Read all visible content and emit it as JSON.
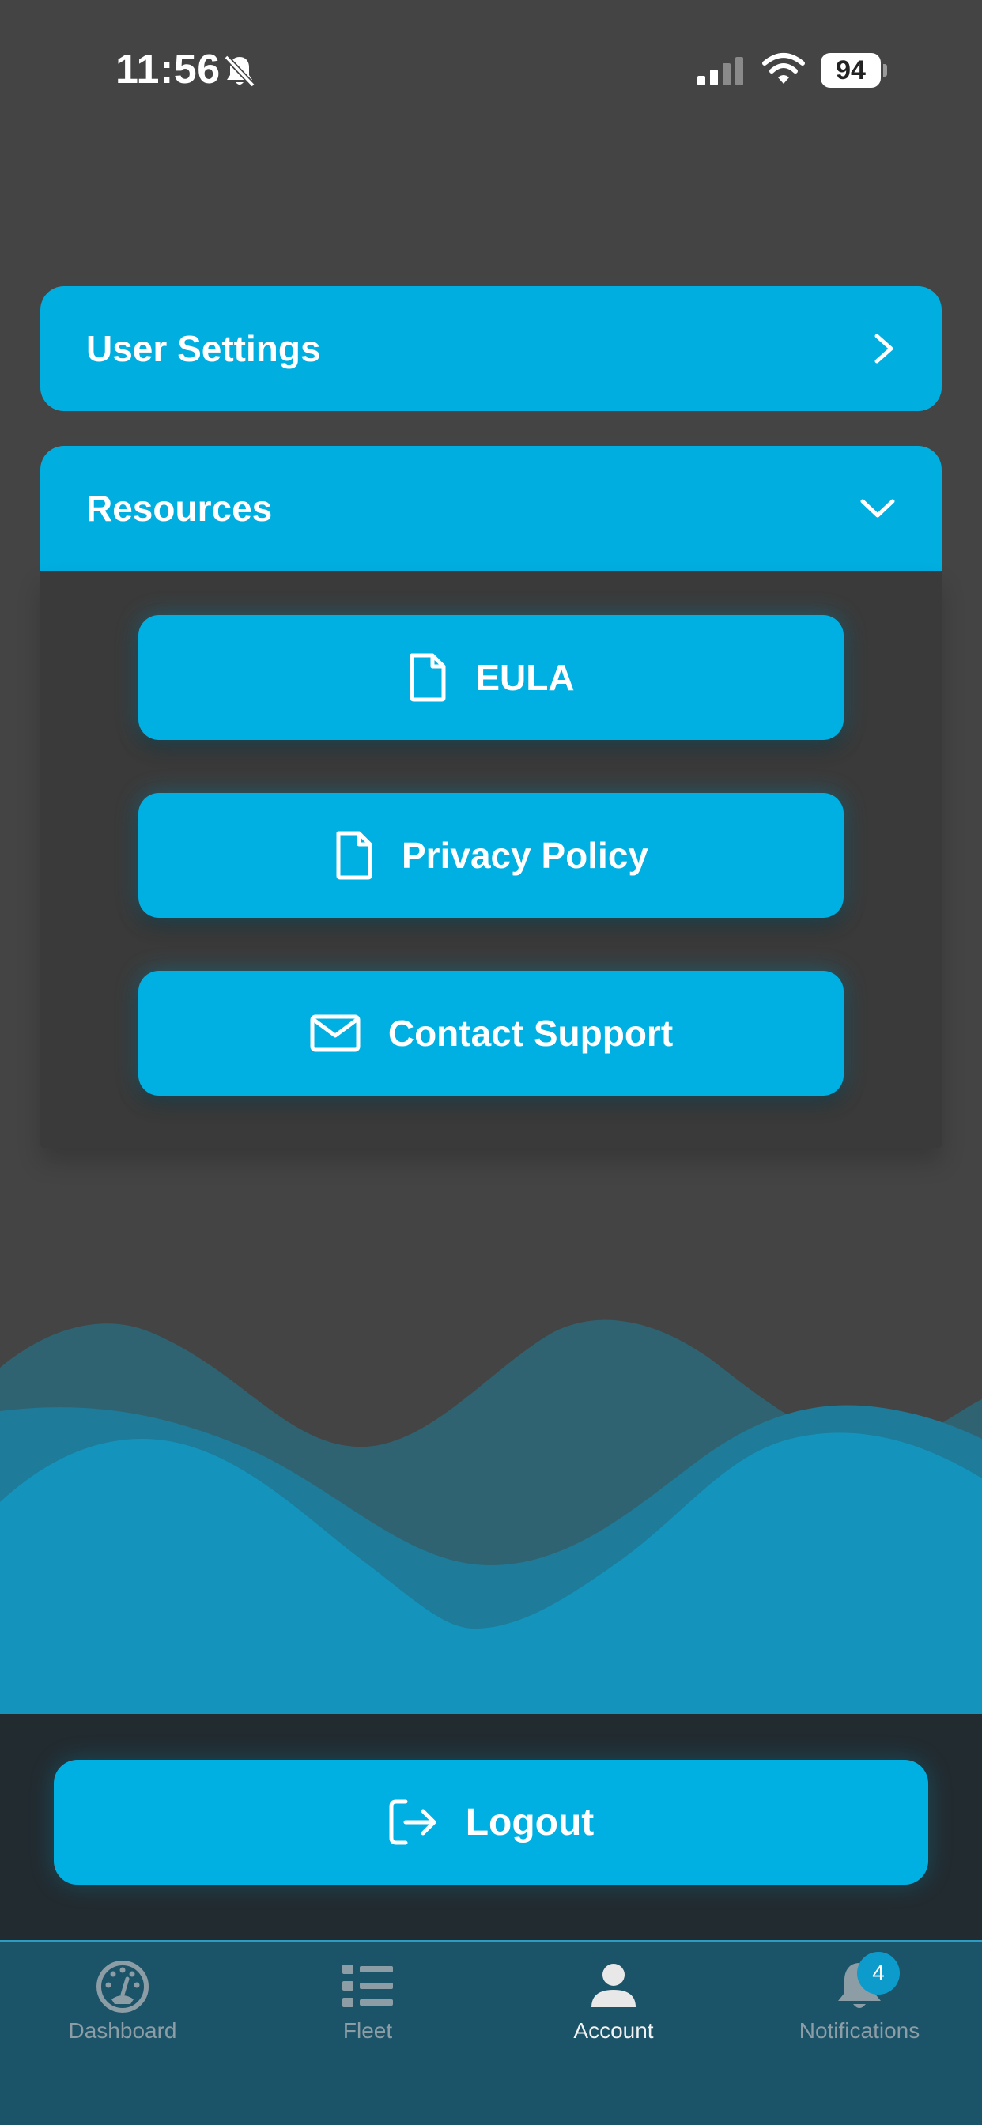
{
  "status_bar": {
    "time": "11:56",
    "battery": "94",
    "icons": [
      "bell-slash-icon",
      "signal-icon",
      "wifi-icon",
      "battery-icon"
    ]
  },
  "menu": {
    "user_settings": {
      "label": "User Settings",
      "icon": "chevron-right-icon"
    },
    "resources": {
      "label": "Resources",
      "icon": "chevron-down-icon",
      "items": [
        {
          "label": "EULA",
          "icon": "document-icon"
        },
        {
          "label": "Privacy Policy",
          "icon": "document-icon"
        },
        {
          "label": "Contact Support",
          "icon": "envelope-icon"
        }
      ]
    }
  },
  "logout": {
    "label": "Logout",
    "icon": "logout-icon"
  },
  "tab_bar": {
    "active": "Account",
    "tabs": [
      {
        "label": "Dashboard",
        "icon": "gauge-icon"
      },
      {
        "label": "Fleet",
        "icon": "list-icon"
      },
      {
        "label": "Account",
        "icon": "person-icon"
      },
      {
        "label": "Notifications",
        "icon": "bell-icon",
        "badge": "4"
      }
    ]
  },
  "colors": {
    "background": "#444444",
    "accent": "#00aee0",
    "tab_bar": "#1b5369",
    "logout_area": "#222b30"
  }
}
